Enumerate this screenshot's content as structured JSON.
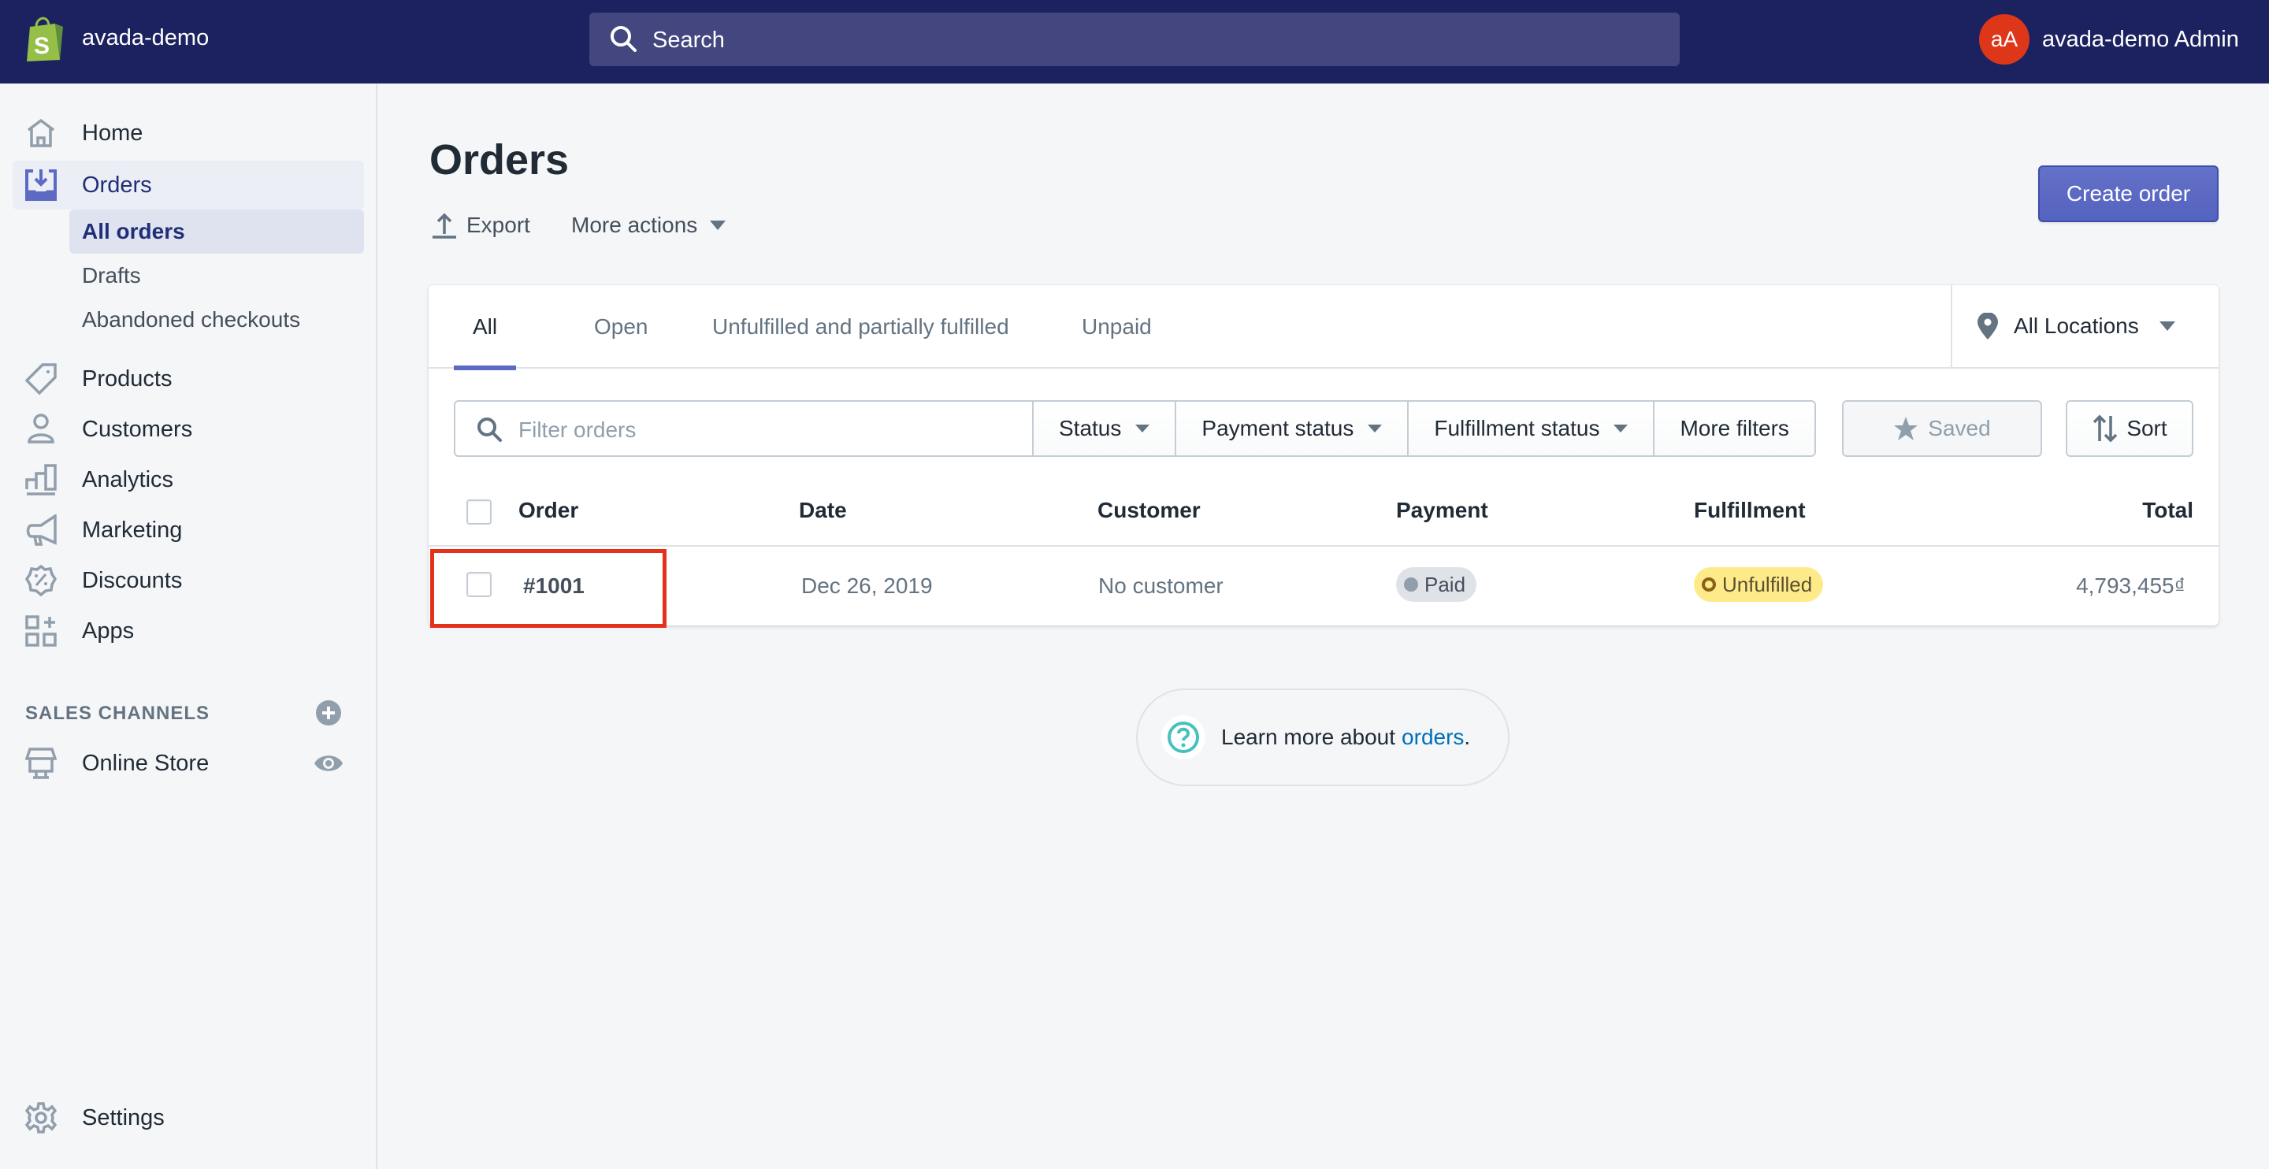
{
  "topbar": {
    "store_name": "avada-demo",
    "search_placeholder": "Search",
    "avatar_initials": "aA",
    "user_name": "avada-demo Admin"
  },
  "sidebar": {
    "items": [
      {
        "label": "Home",
        "icon": "home-icon"
      },
      {
        "label": "Orders",
        "icon": "orders-icon"
      },
      {
        "label": "Products",
        "icon": "tag-icon"
      },
      {
        "label": "Customers",
        "icon": "person-icon"
      },
      {
        "label": "Analytics",
        "icon": "bar-chart-icon"
      },
      {
        "label": "Marketing",
        "icon": "megaphone-icon"
      },
      {
        "label": "Discounts",
        "icon": "discount-icon"
      },
      {
        "label": "Apps",
        "icon": "apps-icon"
      }
    ],
    "orders_subitems": [
      "All orders",
      "Drafts",
      "Abandoned checkouts"
    ],
    "sales_channels_title": "SALES CHANNELS",
    "online_store": "Online Store",
    "settings": "Settings"
  },
  "page": {
    "title": "Orders",
    "export_label": "Export",
    "more_actions_label": "More actions",
    "create_order_label": "Create order"
  },
  "tabs": [
    "All",
    "Open",
    "Unfulfilled and partially fulfilled",
    "Unpaid"
  ],
  "active_tab": "All",
  "location_filter": "All Locations",
  "filters": {
    "search_placeholder": "Filter orders",
    "status": "Status",
    "payment_status": "Payment status",
    "fulfillment_status": "Fulfillment status",
    "more_filters": "More filters",
    "saved": "Saved",
    "sort": "Sort"
  },
  "table": {
    "columns": [
      "Order",
      "Date",
      "Customer",
      "Payment",
      "Fulfillment",
      "Total"
    ],
    "rows": [
      {
        "order": "#1001",
        "date": "Dec 26, 2019",
        "customer": "No customer",
        "payment": "Paid",
        "fulfillment": "Unfulfilled",
        "total": "4,793,455₫"
      }
    ]
  },
  "learn_more": {
    "text": "Learn more about",
    "link": "orders",
    "suffix": "."
  },
  "colors": {
    "topbar": "#1c2260",
    "primary": "#5c6ac4",
    "avatar": "#de3618",
    "paid_badge": "#dfe3e8",
    "unfulfilled_badge": "#ffea8a",
    "link": "#006fbb",
    "highlight": "#e5311c"
  }
}
